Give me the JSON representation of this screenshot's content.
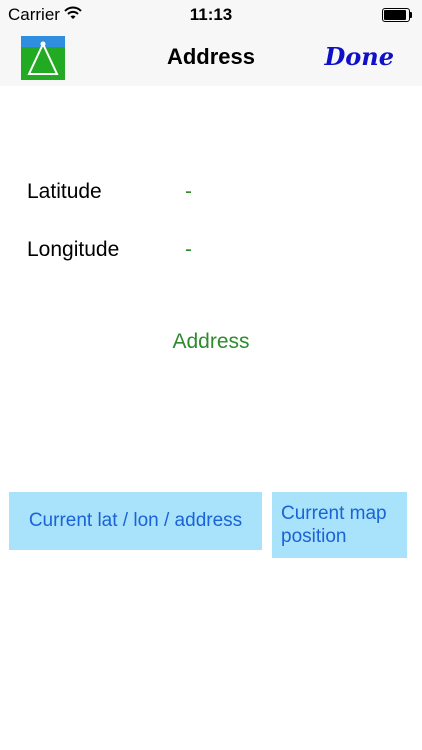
{
  "status_bar": {
    "carrier": "Carrier",
    "time": "11:13",
    "icons": [
      "wifi-icon",
      "battery-icon"
    ]
  },
  "nav": {
    "title": "Address",
    "done_label": "Done",
    "app_icon": "compass-tripod-icon"
  },
  "fields": {
    "latitude_label": "Latitude",
    "latitude_value": "-",
    "longitude_label": "Longitude",
    "longitude_value": "-",
    "address": "Address"
  },
  "buttons": {
    "current_label": "Current lat / lon / address",
    "map_label_line1": "Current map",
    "map_label_line2": "position"
  },
  "colors": {
    "value_green": "#2e8b2e",
    "done_blue": "#1010c8",
    "button_bg": "#a9e2fb",
    "button_text": "#1a63d6"
  }
}
